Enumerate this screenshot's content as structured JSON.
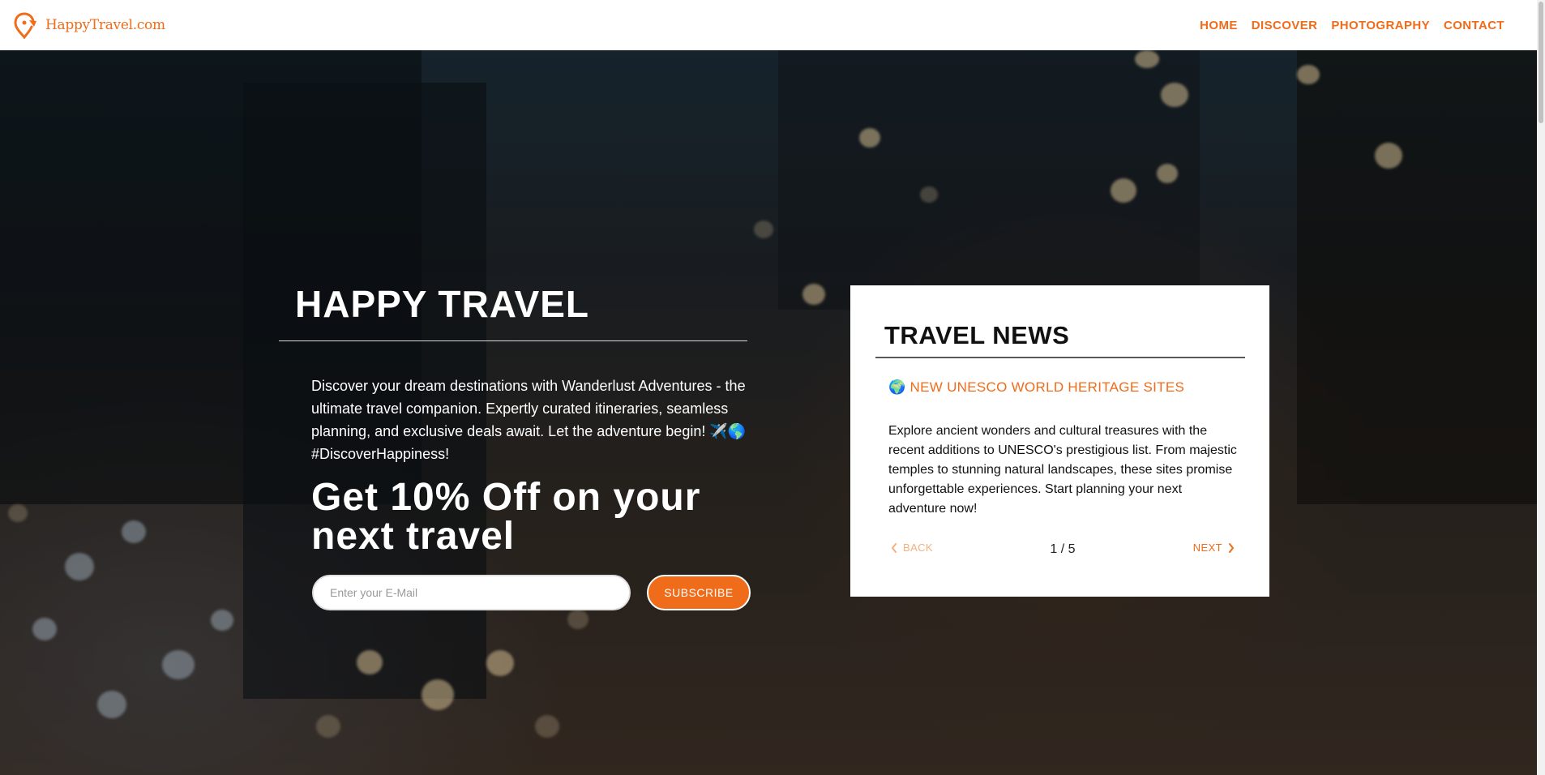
{
  "header": {
    "brand": "HappyTravel.com",
    "logo_icon": "map-pin-arrow-icon",
    "nav": [
      {
        "label": "HOME"
      },
      {
        "label": "DISCOVER"
      },
      {
        "label": "PHOTOGRAPHY"
      },
      {
        "label": "CONTACT"
      }
    ]
  },
  "hero": {
    "title": "HAPPY TRAVEL",
    "description": "Discover your dream destinations with Wanderlust Adventures - the ultimate travel companion. Expertly curated itineraries, seamless planning, and exclusive deals await. Let the adventure begin! ✈️🌎 #DiscoverHappiness!",
    "promo": "Get 10% Off on your next travel",
    "email_placeholder": "Enter your E-Mail",
    "subscribe_label": "SUBSCRIBE"
  },
  "news": {
    "title": "TRAVEL NEWS",
    "headline": "🌍 NEW UNESCO WORLD HERITAGE SITES",
    "body": "Explore ancient wonders and cultural treasures with the recent additions to UNESCO's prestigious list. From majestic temples to stunning natural landscapes, these sites promise unforgettable experiences. Start planning your next adventure now!",
    "back_label": "BACK",
    "next_label": "NEXT",
    "page_indicator": "1 / 5"
  },
  "colors": {
    "accent": "#ef6c1a",
    "accent_muted": "#f4b07f",
    "header_bg": "#ffffff",
    "card_bg": "#ffffff"
  }
}
